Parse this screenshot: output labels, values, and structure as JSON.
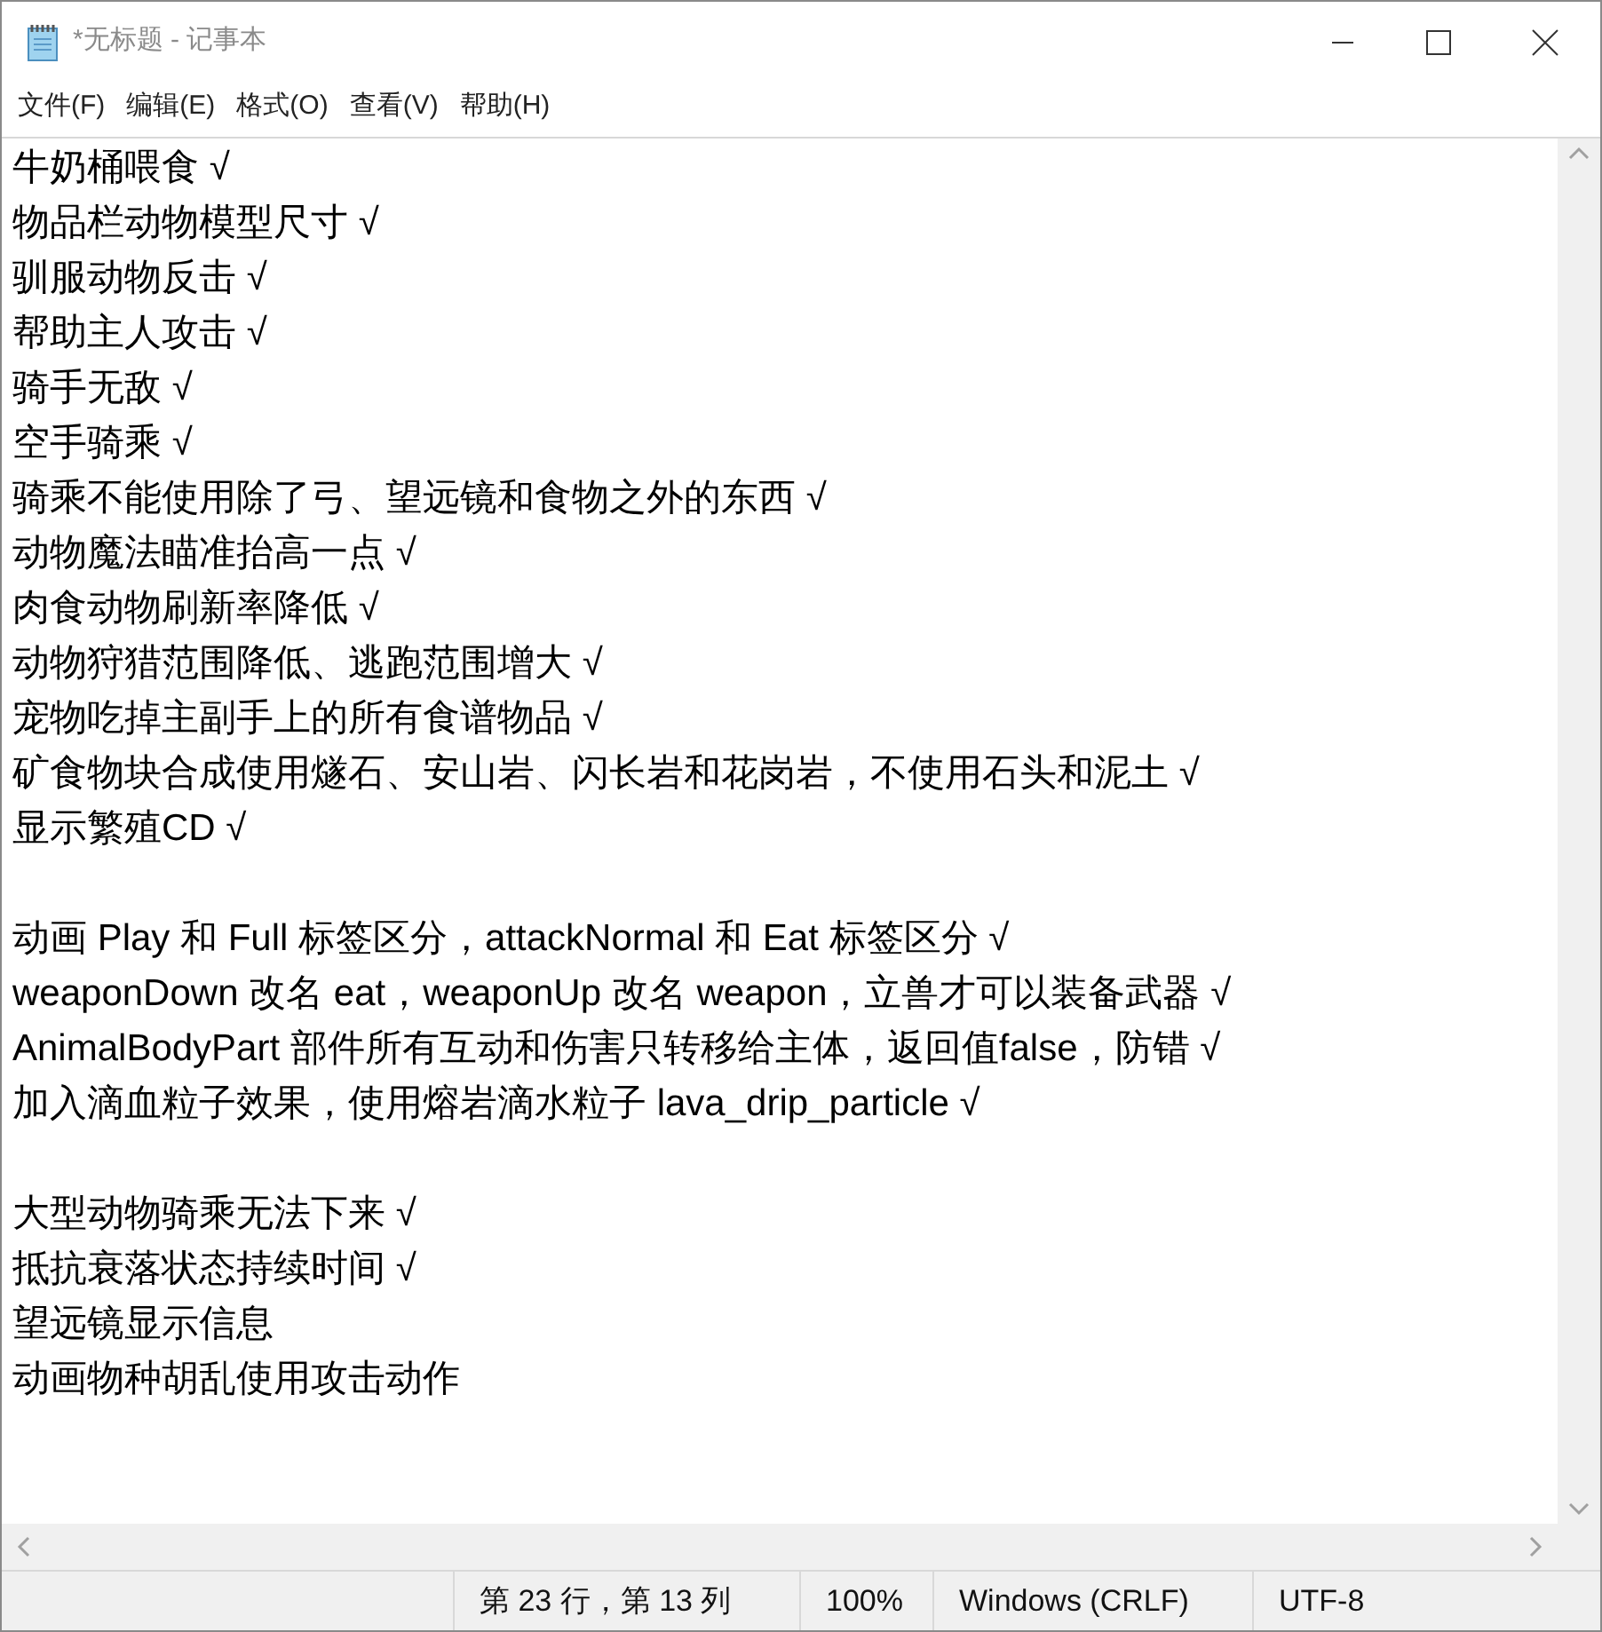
{
  "window": {
    "title": "*无标题 - 记事本"
  },
  "menu": [
    "文件(F)",
    "编辑(E)",
    "格式(O)",
    "查看(V)",
    "帮助(H)"
  ],
  "editor": {
    "blocks": [
      [
        "牛奶桶喂食 √",
        "物品栏动物模型尺寸 √",
        "驯服动物反击 √",
        "帮助主人攻击 √",
        "骑手无敌 √",
        "空手骑乘 √",
        "骑乘不能使用除了弓、望远镜和食物之外的东西 √",
        "动物魔法瞄准抬高一点 √",
        "肉食动物刷新率降低 √",
        "动物狩猎范围降低、逃跑范围增大 √",
        "宠物吃掉主副手上的所有食谱物品 √",
        "矿食物块合成使用燧石、安山岩、闪长岩和花岗岩，不使用石头和泥土 √",
        "显示繁殖CD √"
      ],
      [
        "动画 Play 和 Full 标签区分，attackNormal 和 Eat 标签区分 √",
        "weaponDown 改名 eat，weaponUp 改名 weapon，立兽才可以装备武器 √",
        "AnimalBodyPart 部件所有互动和伤害只转移给主体，返回值false，防错 √",
        "加入滴血粒子效果，使用熔岩滴水粒子 lava_drip_particle √"
      ],
      [
        "大型动物骑乘无法下来 √",
        "抵抗衰落状态持续时间 √",
        "望远镜显示信息",
        "动画物种胡乱使用攻击动作"
      ]
    ]
  },
  "status_bar": [
    "第 23 行，第 13 列",
    "100%",
    "Windows (CRLF)",
    "UTF-8"
  ]
}
